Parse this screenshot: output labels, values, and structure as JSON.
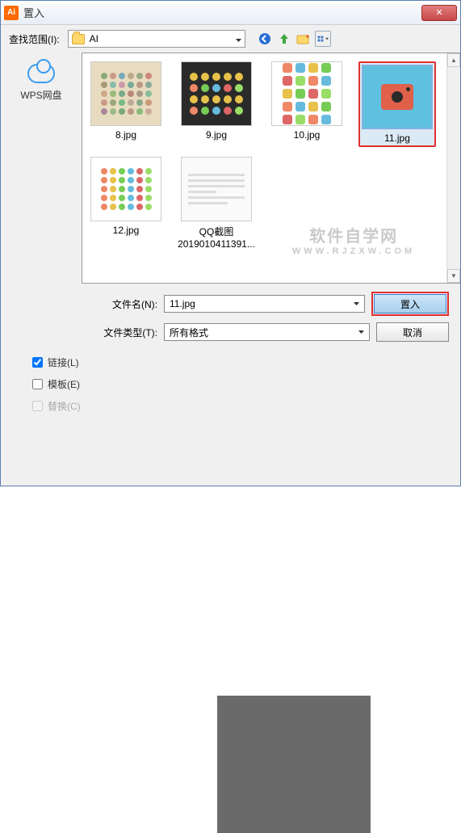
{
  "window": {
    "title": "置入"
  },
  "toolbar": {
    "lookin_label": "查找范围(I):",
    "location": "AI"
  },
  "sidebar": {
    "wps_label": "WPS网盘"
  },
  "files": {
    "f8": "8.jpg",
    "f9": "9.jpg",
    "f10": "10.jpg",
    "f11": "11.jpg",
    "f12": "12.jpg",
    "fqq_line1": "QQ截图",
    "fqq_line2": "201901041139​1..."
  },
  "watermark": {
    "main": "软件自学网",
    "sub": "WWW.RJZXW.COM"
  },
  "form": {
    "filename_label": "文件名(N):",
    "filename_value": "11.jpg",
    "filetype_label": "文件类型(T):",
    "filetype_value": "所有格式",
    "place_btn": "置入",
    "cancel_btn": "取消"
  },
  "checks": {
    "link": "链接(L)",
    "template": "模板(E)",
    "replace": "替换(C)"
  }
}
